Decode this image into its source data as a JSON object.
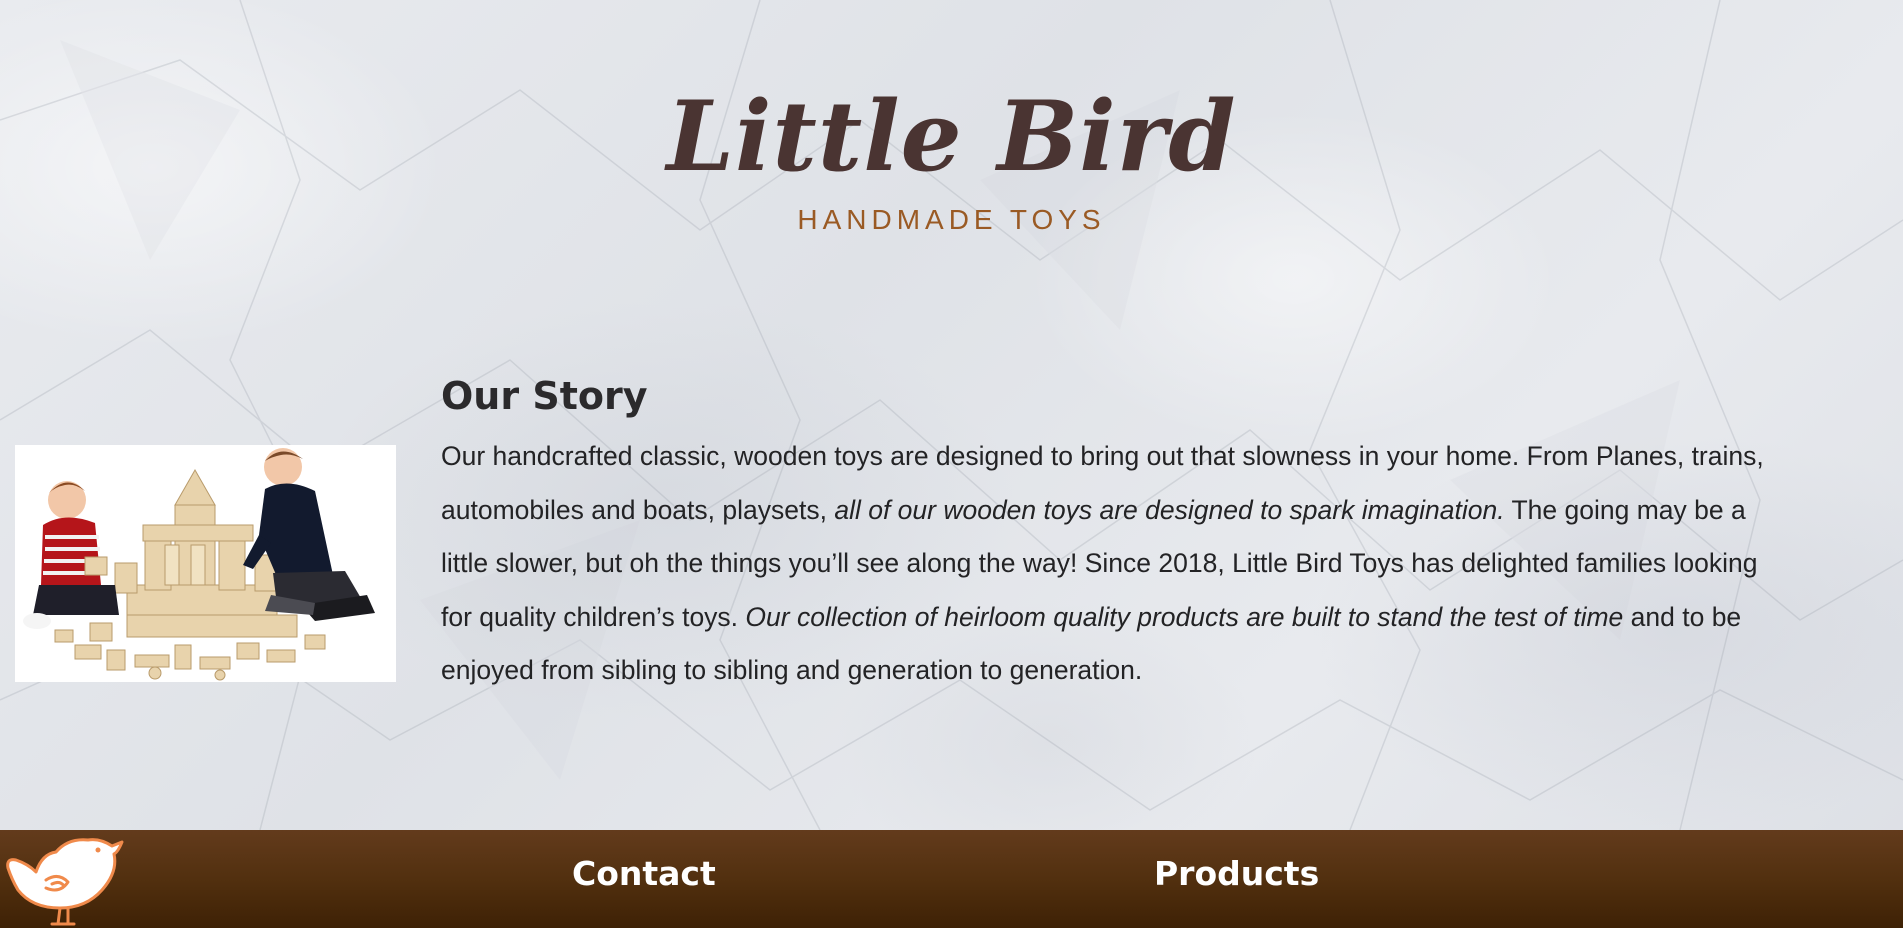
{
  "brand": {
    "title": "Little Bird",
    "subtitle": "HANDMADE TOYS"
  },
  "story": {
    "heading": "Our Story",
    "image_alt": "two boys playing with wooden block toys",
    "paragraph": {
      "p1": "Our handcrafted classic, wooden toys are designed to bring out that slowness in your home. From Planes, trains, automobiles and boats, playsets, ",
      "em1": "all of our wooden toys are designed to spark imagination.",
      "p2": " The going may be a little slower, but oh the things you’ll see along the way! Since 2018, Little Bird Toys has delighted families looking for quality children’s toys. ",
      "em2": "Our collection of heirloom quality products are built to stand the test of time",
      "p3": " and to be enjoyed from sibling to sibling and generation to generation."
    }
  },
  "footer": {
    "logo_icon": "bird-icon",
    "contact_label": "Contact",
    "products_label": "Products"
  },
  "colors": {
    "brand_title": "#4a3432",
    "brand_subtitle": "#9a5a24",
    "footer_background": "#52300f",
    "footer_text": "#ffffff",
    "logo_orange": "#f08a4b"
  }
}
